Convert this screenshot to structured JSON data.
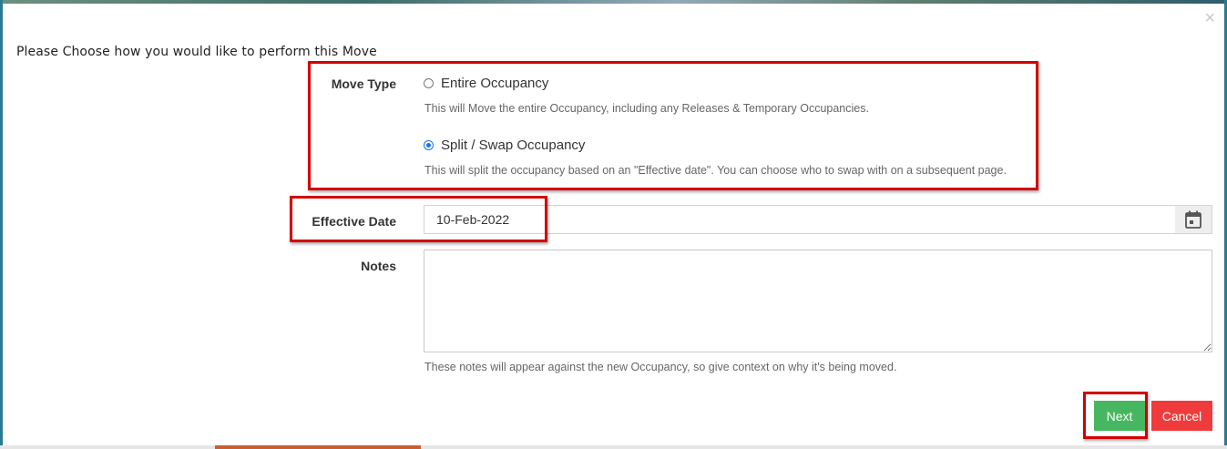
{
  "dialog": {
    "close_glyph": "×",
    "intro": "Please Choose how you would like to perform this Move"
  },
  "move_type": {
    "label": "Move Type",
    "options": [
      {
        "label": "Entire Occupancy",
        "help": "This will Move the entire Occupancy, including any Releases & Temporary Occupancies.",
        "selected": false
      },
      {
        "label": "Split / Swap Occupancy",
        "help": "This will split the occupancy based on an \"Effective date\". You can choose who to swap with on a subsequent page.",
        "selected": true
      }
    ]
  },
  "effective_date": {
    "label": "Effective Date",
    "value": "10-Feb-2022",
    "icon": "calendar-icon"
  },
  "notes": {
    "label": "Notes",
    "value": "",
    "help": "These notes will appear against the new Occupancy, so give context on why it's being moved."
  },
  "buttons": {
    "next": "Next",
    "cancel": "Cancel"
  },
  "colors": {
    "next": "#46b760",
    "cancel": "#ef3b3b",
    "highlight": "#d40000"
  }
}
